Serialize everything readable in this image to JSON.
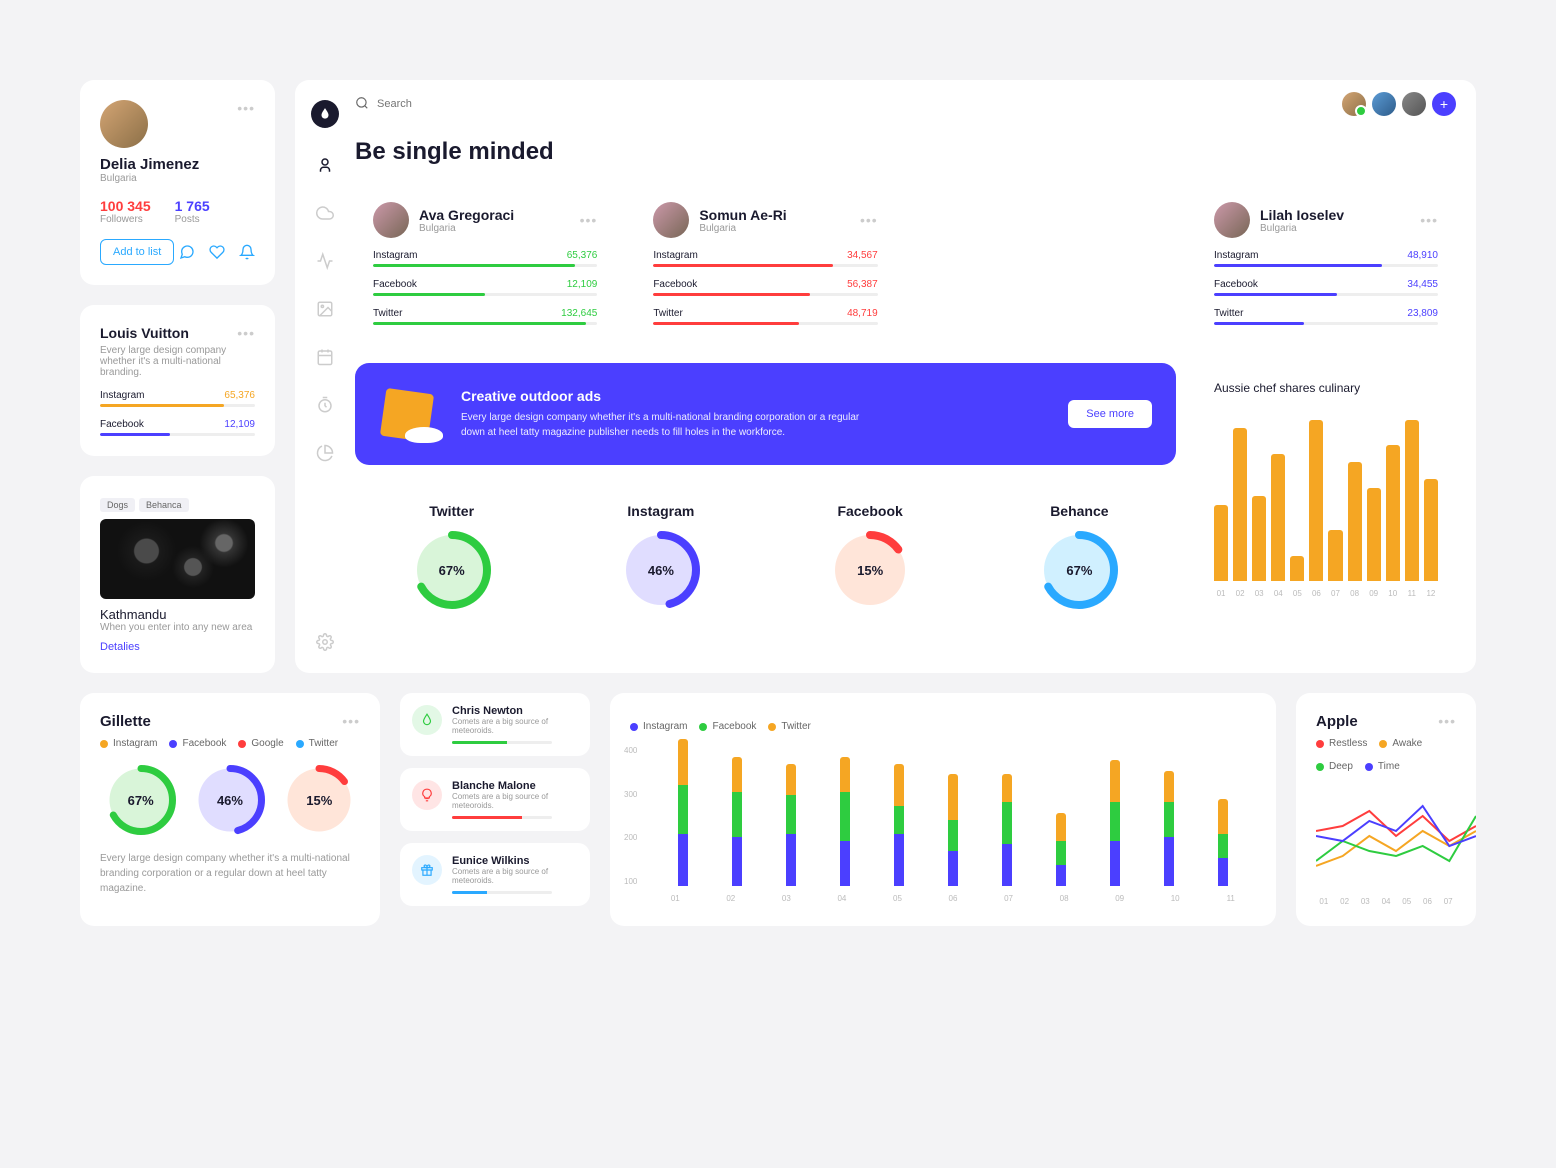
{
  "profile": {
    "name": "Delia Jimenez",
    "location": "Bulgaria",
    "followers": "100 345",
    "followers_label": "Followers",
    "posts": "1 765",
    "posts_label": "Posts",
    "add_list": "Add to list"
  },
  "louis": {
    "title": "Louis Vuitton",
    "desc": "Every large design company whether it's a multi-national branding.",
    "metrics": [
      {
        "label": "Instagram",
        "value": "65,376",
        "color": "#f5a623",
        "pct": 80
      },
      {
        "label": "Facebook",
        "value": "12,109",
        "color": "#4b3fff",
        "pct": 45
      }
    ]
  },
  "kathmandu": {
    "tags": [
      "Dogs",
      "Behanca"
    ],
    "title": "Kathmandu",
    "sub": "When you enter into any new area",
    "link": "Detalies"
  },
  "search": {
    "placeholder": "Search"
  },
  "page_title": "Be single minded",
  "persons": [
    {
      "name": "Ava Gregoraci",
      "loc": "Bulgaria",
      "color": "#2ecc40",
      "metrics": [
        {
          "label": "Instagram",
          "value": "65,376",
          "pct": 90
        },
        {
          "label": "Facebook",
          "value": "12,109",
          "pct": 50
        },
        {
          "label": "Twitter",
          "value": "132,645",
          "pct": 95
        }
      ]
    },
    {
      "name": "Somun Ae-Ri",
      "loc": "Bulgaria",
      "color": "#ff3d3d",
      "metrics": [
        {
          "label": "Instagram",
          "value": "34,567",
          "pct": 80
        },
        {
          "label": "Facebook",
          "value": "56,387",
          "pct": 70
        },
        {
          "label": "Twitter",
          "value": "48,719",
          "pct": 65
        }
      ]
    },
    {
      "name": "Lilah Ioselev",
      "loc": "Bulgaria",
      "color": "#4b3fff",
      "metrics": [
        {
          "label": "Instagram",
          "value": "48,910",
          "pct": 75
        },
        {
          "label": "Facebook",
          "value": "34,455",
          "pct": 55
        },
        {
          "label": "Twitter",
          "value": "23,809",
          "pct": 40
        }
      ]
    }
  ],
  "banner": {
    "title": "Creative outdoor ads",
    "body": "Every large design company whether it's a multi-national branding corporation or a regular down at heel tatty magazine publisher needs to fill holes in the workforce.",
    "cta": "See more"
  },
  "donuts": [
    {
      "title": "Twitter",
      "pct": 67,
      "ring": "#2ecc40",
      "bg": "#d9f5d9"
    },
    {
      "title": "Instagram",
      "pct": 46,
      "ring": "#4b3fff",
      "bg": "#e0ddff"
    },
    {
      "title": "Facebook",
      "pct": 15,
      "ring": "#ff3d3d",
      "bg": "#ffe5d9"
    },
    {
      "title": "Behance",
      "pct": 67,
      "ring": "#2aa9ff",
      "bg": "#d0f0ff"
    }
  ],
  "culinary": {
    "title": "Aussie chef shares culinary"
  },
  "gillette": {
    "title": "Gillette",
    "legend": [
      {
        "label": "Instagram",
        "color": "#f5a623"
      },
      {
        "label": "Facebook",
        "color": "#4b3fff"
      },
      {
        "label": "Google",
        "color": "#ff3d3d"
      },
      {
        "label": "Twitter",
        "color": "#2aa9ff"
      }
    ],
    "footer": "Every large design company whether it's a multi-national branding corporation or a regular down at heel tatty magazine."
  },
  "people_list": [
    {
      "name": "Chris Newton",
      "sub": "Comets are a big source of meteoroids.",
      "color": "#2ecc40",
      "icon": "fire",
      "pct": 55
    },
    {
      "name": "Blanche Malone",
      "sub": "Comets are a big source of meteoroids.",
      "color": "#ff3d3d",
      "icon": "bulb",
      "pct": 70
    },
    {
      "name": "Eunice Wilkins",
      "sub": "Comets are a big source of meteoroids.",
      "color": "#2aa9ff",
      "icon": "gift",
      "pct": 35
    }
  ],
  "stacked": {
    "legend": [
      {
        "label": "Instagram",
        "color": "#4b3fff"
      },
      {
        "label": "Facebook",
        "color": "#2ecc40"
      },
      {
        "label": "Twitter",
        "color": "#f5a623"
      }
    ]
  },
  "apple": {
    "title": "Apple",
    "legend": [
      {
        "label": "Restless",
        "color": "#ff3d3d"
      },
      {
        "label": "Awake",
        "color": "#f5a623"
      },
      {
        "label": "Deep",
        "color": "#2ecc40"
      },
      {
        "label": "Time",
        "color": "#4b3fff"
      }
    ]
  },
  "chart_data": [
    {
      "id": "culinary",
      "type": "bar",
      "title": "Aussie chef shares culinary",
      "categories": [
        "01",
        "02",
        "03",
        "04",
        "05",
        "06",
        "07",
        "08",
        "09",
        "10",
        "11",
        "12"
      ],
      "values": [
        45,
        90,
        50,
        75,
        15,
        95,
        30,
        70,
        55,
        80,
        95,
        60
      ],
      "ylim": [
        0,
        100
      ]
    },
    {
      "id": "gillette_donuts",
      "type": "pie",
      "series": [
        {
          "name": "Twitter",
          "values": [
            67
          ]
        },
        {
          "name": "Instagram",
          "values": [
            46
          ]
        },
        {
          "name": "Facebook",
          "values": [
            15
          ]
        }
      ]
    },
    {
      "id": "stacked",
      "type": "bar",
      "stacked": true,
      "categories": [
        "01",
        "02",
        "03",
        "04",
        "05",
        "06",
        "07",
        "08",
        "09",
        "10",
        "11"
      ],
      "series": [
        {
          "name": "Instagram",
          "values": [
            150,
            140,
            150,
            130,
            150,
            100,
            120,
            60,
            130,
            140,
            80
          ]
        },
        {
          "name": "Facebook",
          "values": [
            140,
            130,
            110,
            140,
            80,
            90,
            120,
            70,
            110,
            100,
            70
          ]
        },
        {
          "name": "Twitter",
          "values": [
            130,
            100,
            90,
            100,
            120,
            130,
            80,
            80,
            120,
            90,
            100
          ]
        }
      ],
      "ylim": [
        0,
        400
      ],
      "yticks": [
        100,
        200,
        300,
        400
      ]
    },
    {
      "id": "apple",
      "type": "line",
      "x": [
        "01",
        "02",
        "03",
        "04",
        "05",
        "06",
        "07"
      ],
      "series": [
        {
          "name": "Restless",
          "values": [
            55,
            60,
            75,
            50,
            70,
            45,
            60
          ]
        },
        {
          "name": "Awake",
          "values": [
            20,
            30,
            50,
            35,
            55,
            40,
            55
          ]
        },
        {
          "name": "Deep",
          "values": [
            25,
            45,
            35,
            30,
            40,
            25,
            70
          ]
        },
        {
          "name": "Time",
          "values": [
            50,
            45,
            65,
            55,
            80,
            40,
            50
          ]
        }
      ],
      "ylim": [
        0,
        100
      ]
    }
  ]
}
